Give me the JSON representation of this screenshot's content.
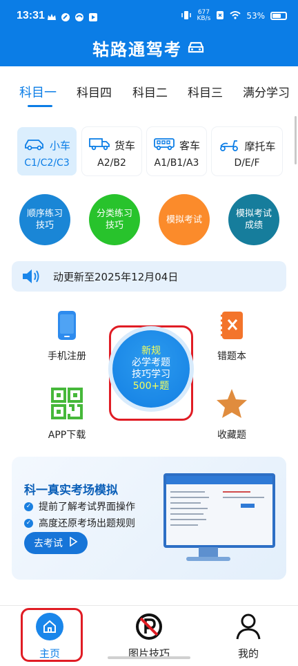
{
  "status_bar": {
    "time": "13:31",
    "speed_top": "677",
    "speed_unit": "KB/s",
    "battery": "53%"
  },
  "header": {
    "title": "轱路通驾考"
  },
  "tabs": [
    {
      "label": "科目一",
      "active": true
    },
    {
      "label": "科目四",
      "active": false
    },
    {
      "label": "科目二",
      "active": false
    },
    {
      "label": "科目三",
      "active": false
    },
    {
      "label": "满分学习",
      "active": false
    }
  ],
  "vehicles": [
    {
      "name": "小车",
      "licenses": "C1/C2/C3",
      "icon": "car-icon",
      "active": true
    },
    {
      "name": "货车",
      "licenses": "A2/B2",
      "icon": "truck-icon",
      "active": false
    },
    {
      "name": "客车",
      "licenses": "A1/B1/A3",
      "icon": "bus-icon",
      "active": false
    },
    {
      "name": "摩托车",
      "licenses": "D/E/F",
      "icon": "scooter-icon",
      "active": false
    }
  ],
  "practice_buttons": [
    {
      "line1": "顺序练习",
      "line2": "技巧",
      "color": "#1a86d6"
    },
    {
      "line1": "分类练习",
      "line2": "技巧",
      "color": "#28c32c"
    },
    {
      "line1": "模拟考试",
      "line2": "",
      "color": "#fb8b2b"
    },
    {
      "line1": "模拟考试",
      "line2": "成绩",
      "color": "#167d9c"
    }
  ],
  "notice": {
    "text": "动更新至2025年12月04日"
  },
  "grid": {
    "phone_register": "手机注册",
    "wrong_book": "错题本",
    "app_download": "APP下载",
    "favorites": "收藏题",
    "center": {
      "line1": "新规",
      "line2": "必学考题",
      "line3": "技巧学习",
      "line4": "500+题"
    }
  },
  "banner": {
    "title": "科一真实考场模拟",
    "point1": "提前了解考试界面操作",
    "point2": "高度还原考场出题规则",
    "button": "去考试"
  },
  "bottom_nav": {
    "home": "主页",
    "picture_tips": "图片技巧",
    "mine": "我的"
  },
  "colors": {
    "primary": "#0b7de6",
    "highlight_red": "#e01c24"
  }
}
